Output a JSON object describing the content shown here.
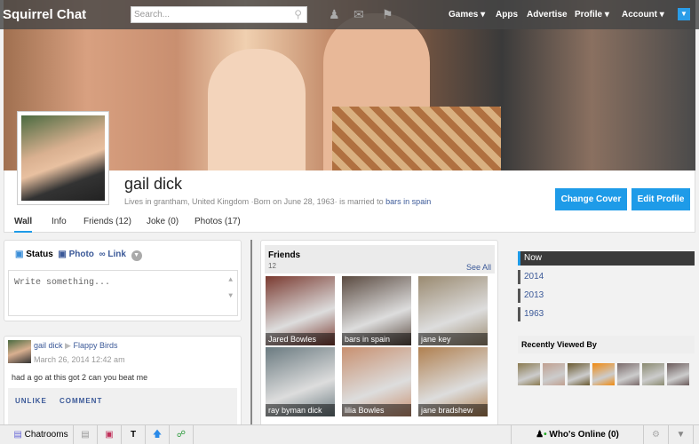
{
  "app": {
    "title": "Squirrel Chat"
  },
  "topbar": {
    "search_placeholder": "Search...",
    "nav": [
      "Games ▾",
      "Apps",
      "Advertise",
      "Profile ▾",
      "Account ▾"
    ]
  },
  "profile": {
    "name": "gail dick",
    "bio_prefix": "Lives in grantham, United Kingdom ·Born on June 28, 1963· is married to ",
    "spouse": "bars in spain",
    "change_cover": "Change Cover",
    "edit_profile": "Edit Profile"
  },
  "tabs": [
    "Wall",
    "Info",
    "Friends (12)",
    "Joke (0)",
    "Photos (17)"
  ],
  "composer": {
    "status": "Status",
    "photo": "Photo",
    "link": "Link",
    "placeholder": "Write something..."
  },
  "post": {
    "author": "gail dick",
    "target": "Flappy Birds",
    "time": "March 26, 2014 12:42 am",
    "text": "had a go at this got 2 can you beat me",
    "unlike": "UNLIKE",
    "comment": "COMMENT"
  },
  "friends": {
    "title": "Friends",
    "count": "12",
    "see_all": "See All",
    "items": [
      {
        "name": "Jared Bowles",
        "color": "#7a3a30"
      },
      {
        "name": "bars in spain",
        "color": "#5a4a40"
      },
      {
        "name": "jane key",
        "color": "#9a8a70"
      },
      {
        "name": "ray byman dick",
        "color": "#6a7a80"
      },
      {
        "name": "lilia Bowles",
        "color": "#c89070"
      },
      {
        "name": "jane bradshew",
        "color": "#b08050"
      }
    ]
  },
  "timeline": {
    "items": [
      "Now",
      "2014",
      "2013",
      "1963"
    ]
  },
  "recently_viewed": {
    "title": "Recently Viewed By",
    "colors": [
      "#8a7a50",
      "#c0a090",
      "#6a5a30",
      "#f08a10",
      "#7a6a6a",
      "#8a8a70",
      "#6a5a5a"
    ]
  },
  "bottom": {
    "chatrooms": "Chatrooms",
    "whos_online": "Who's Online (0)"
  }
}
